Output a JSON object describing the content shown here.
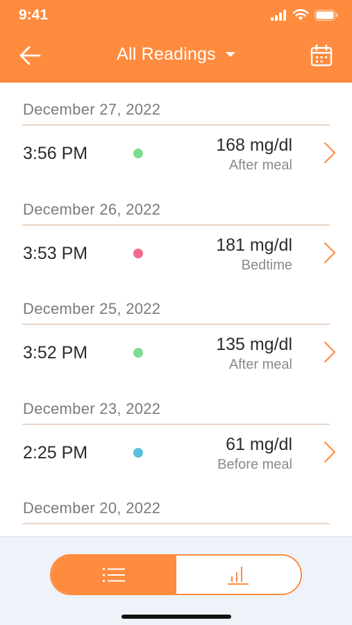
{
  "status_bar": {
    "time": "9:41"
  },
  "header": {
    "title": "All Readings"
  },
  "readings": [
    {
      "date": "December 27, 2022",
      "time": "3:56 PM",
      "value": "168 mg/dl",
      "context": "After meal",
      "dot_color": "#7DDB8E"
    },
    {
      "date": "December 26, 2022",
      "time": "3:53 PM",
      "value": "181 mg/dl",
      "context": "Bedtime",
      "dot_color": "#EE6C8A"
    },
    {
      "date": "December 25, 2022",
      "time": "3:52 PM",
      "value": "135 mg/dl",
      "context": "After meal",
      "dot_color": "#7DDB8E"
    },
    {
      "date": "December 23, 2022",
      "time": "2:25 PM",
      "value": "61 mg/dl",
      "context": "Before meal",
      "dot_color": "#5BC0E0"
    },
    {
      "date": "December 20, 2022",
      "time": "",
      "value": "",
      "context": "",
      "dot_color": ""
    }
  ],
  "view_toggle": {
    "active": "list",
    "options": [
      "list-icon",
      "chart-icon"
    ]
  },
  "colors": {
    "accent": "#FF8B3F",
    "divider": "#E8D4C6",
    "bottom_bg": "#EEF3FA"
  }
}
